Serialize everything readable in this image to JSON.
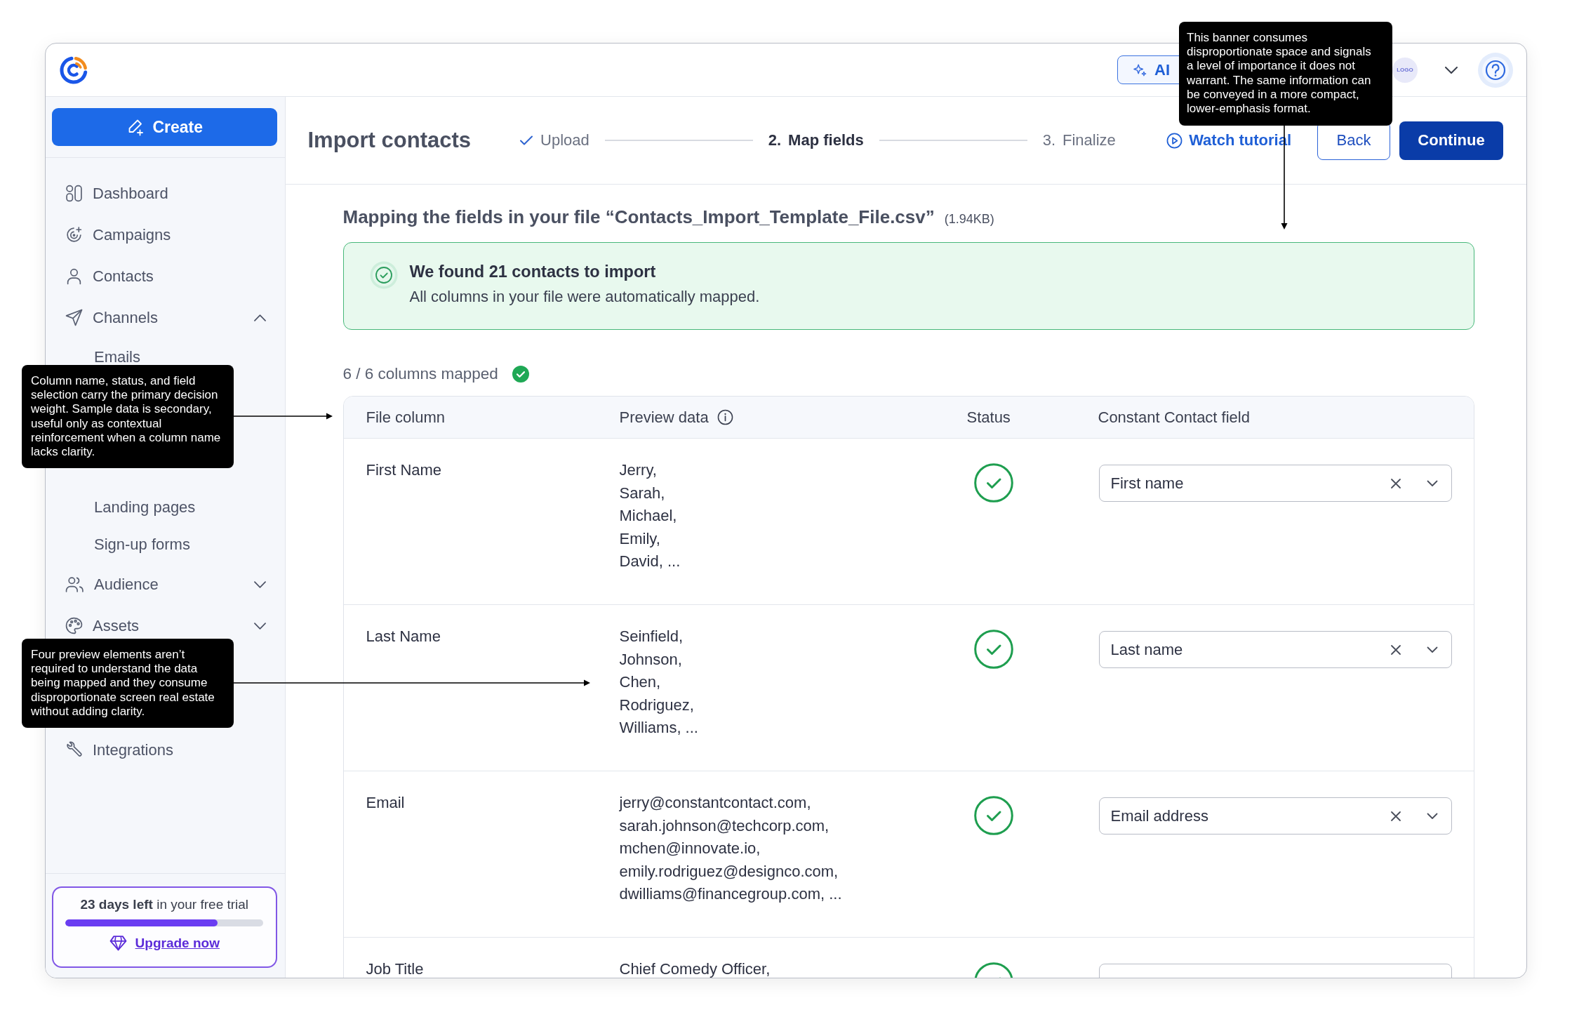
{
  "topbar": {
    "ai_button": "AI",
    "account_logo": "LOGO"
  },
  "sidebar": {
    "create_button": "Create",
    "items": [
      {
        "label": "Dashboard",
        "kind": "link"
      },
      {
        "label": "Campaigns",
        "kind": "link"
      },
      {
        "label": "Contacts",
        "kind": "link"
      },
      {
        "label": "Channels",
        "kind": "group",
        "expanded": true,
        "children": [
          {
            "label": "Emails"
          },
          {
            "label": "Landing pages"
          },
          {
            "label": "Sign-up forms"
          }
        ]
      },
      {
        "label": "Audience",
        "kind": "group",
        "expanded": false
      },
      {
        "label": "Assets",
        "kind": "group",
        "expanded": false
      },
      {
        "label": "Integrations",
        "kind": "link"
      }
    ],
    "trial": {
      "text": "**23 days left** in your free trial",
      "level": 0.77,
      "link": "Upgrade now"
    }
  },
  "header": {
    "title": "Import contacts",
    "steps": [
      {
        "label": "Upload",
        "completed": true,
        "selected": false
      },
      {
        "number": "2.",
        "label": "Map fields",
        "completed": false,
        "selected": true
      },
      {
        "number": "3.",
        "label": "Finalize",
        "completed": false,
        "selected": false
      }
    ],
    "tutorial_link": "Watch tutorial",
    "back_button": "Back",
    "continue_button": "Continue"
  },
  "content": {
    "heading": "Mapping the fields in your file “Contacts_Import_Template_File.csv”",
    "file_size": "(1.94KB)",
    "banner": {
      "title": "We found 21 contacts to import",
      "message": "All columns in your file were automatically mapped."
    },
    "mapped_count": "6 / 6 columns mapped",
    "table": {
      "columns": [
        {
          "label": "File column",
          "info": false
        },
        {
          "label": "Preview data",
          "info": true
        },
        {
          "label": "Status",
          "info": false
        },
        {
          "label": "Constant Contact field",
          "info": false
        }
      ],
      "rows": [
        {
          "file_column": "First Name",
          "preview": [
            "Jerry,",
            "Sarah,",
            "Michael,",
            "Emily,",
            "David, ..."
          ],
          "mapped": true,
          "field": "First name"
        },
        {
          "file_column": "Last Name",
          "preview": [
            "Seinfield,",
            "Johnson,",
            "Chen,",
            "Rodriguez,",
            "Williams, ..."
          ],
          "mapped": true,
          "field": "Last name"
        },
        {
          "file_column": "Email",
          "preview": [
            "jerry@constantcontact.com,",
            "sarah.johnson@techcorp.com,",
            "mchen@innovate.io,",
            "emily.rodriguez@designco.com,",
            "dwilliams@financegroup.com, ..."
          ],
          "mapped": true,
          "field": "Email address"
        },
        {
          "file_column": "Job Title",
          "preview": [
            "Chief Comedy Officer,"
          ],
          "mapped": true
        }
      ]
    }
  },
  "annotations": [
    {
      "text": "This banner consumes disproportionate space and signals a level of importance it does not warrant. The same information can be conveyed in a more compact, lower-emphasis format."
    },
    {
      "text": "Column name, status, and field selection carry the primary decision weight. Sample data is secondary, useful only as contextual reinforcement when a column name lacks clarity."
    },
    {
      "text": "Four preview elements aren’t required to understand the data being mapped and they consume disproportionate screen real estate without adding clarity."
    }
  ]
}
